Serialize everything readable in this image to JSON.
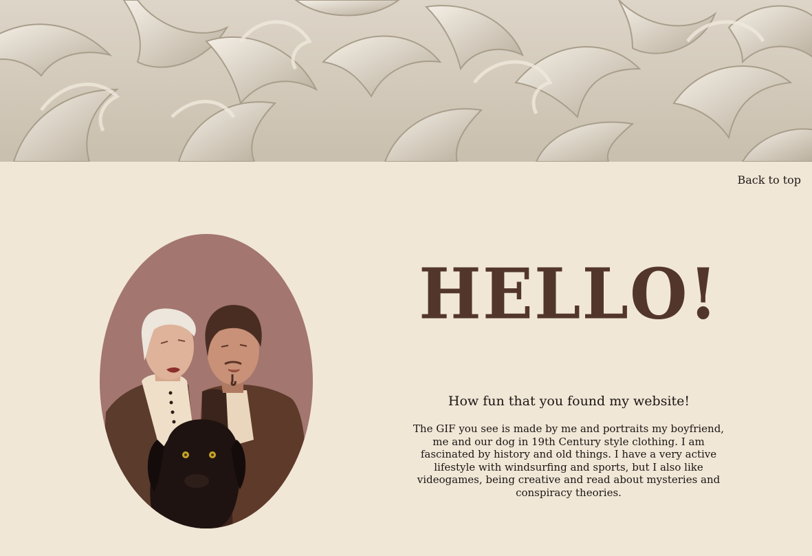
{
  "banner": {
    "alt": "ornamental plaster relief"
  },
  "nav": {
    "back_to_top": "Back to top"
  },
  "hero": {
    "heading": "HELLO!",
    "subtitle": "How fun that you found my website!",
    "intro": "The GIF you see is made by me and portraits my boyfriend, me and our dog in 19th Century style clothing. I am fascinated by history and old things. I have a very active lifestyle with windsurfing and sports, but I also like videogames, being creative and read about mysteries and conspiracy theories."
  },
  "colors": {
    "page_bg": "#f1e7d7",
    "heading": "#53362b",
    "portrait_bg": "#a3766f"
  }
}
